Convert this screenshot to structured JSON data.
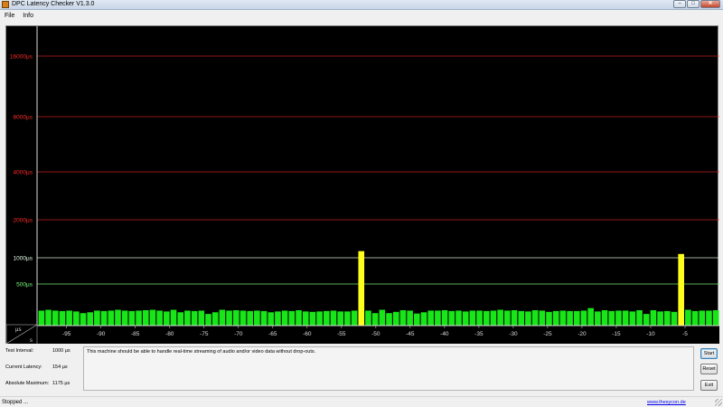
{
  "window": {
    "title": "DPC Latency Checker V1.3.0"
  },
  "menu": {
    "items": [
      "File",
      "Info"
    ]
  },
  "chart_data": {
    "type": "bar",
    "x_unit": "s",
    "y_unit": "µs",
    "y_reference_lines": [
      {
        "label": "16000µs",
        "value": 16000,
        "color": "#ff2a2a"
      },
      {
        "label": "8000µs",
        "value": 8000,
        "color": "#ff2a2a"
      },
      {
        "label": "4000µs",
        "value": 4000,
        "color": "#ff2a2a"
      },
      {
        "label": "2000µs",
        "value": 2000,
        "color": "#ff2a2a"
      },
      {
        "label": "1000µs",
        "value": 1000,
        "color": "#e8ffe8"
      },
      {
        "label": "500µs",
        "value": 500,
        "color": "#7dff7d"
      }
    ],
    "x_ticks": [
      -95,
      -90,
      -85,
      -80,
      -75,
      -70,
      -65,
      -60,
      -55,
      -50,
      -45,
      -40,
      -35,
      -30,
      -25,
      -20,
      -15,
      -10,
      -5
    ],
    "x_range": [
      -99.3,
      0
    ],
    "values": [
      180,
      190,
      180,
      175,
      180,
      170,
      150,
      160,
      180,
      175,
      180,
      190,
      180,
      175,
      180,
      185,
      190,
      180,
      170,
      190,
      160,
      180,
      175,
      180,
      140,
      160,
      190,
      180,
      185,
      180,
      175,
      180,
      175,
      160,
      170,
      180,
      175,
      185,
      170,
      165,
      170,
      175,
      180,
      170,
      170,
      180,
      1175,
      180,
      150,
      190,
      150,
      165,
      185,
      180,
      145,
      160,
      180,
      180,
      185,
      175,
      180,
      170,
      180,
      180,
      175,
      180,
      190,
      180,
      185,
      175,
      170,
      185,
      180,
      165,
      175,
      180,
      175,
      175,
      180,
      210,
      170,
      185,
      175,
      180,
      180,
      170,
      185,
      140,
      185,
      170,
      175,
      165,
      1100,
      190,
      175,
      180,
      180,
      185
    ],
    "bar_colors": {
      "normal": "#19e619",
      "warning": "#ffff1e"
    }
  },
  "fields": [
    {
      "label": "Test Interval:",
      "value": "1000 µs"
    },
    {
      "label": "Current Latency:",
      "value": "154 µs"
    },
    {
      "label": "Absolute Maximum:",
      "value": "1175 µs"
    }
  ],
  "message": "This machine should be able to handle real-time streaming of audio and/or video data without drop-outs.",
  "buttons": {
    "start": "Start",
    "reset": "Reset",
    "exit": "Exit"
  },
  "status": {
    "text": "Stopped ...",
    "link": "www.thesycon.de"
  }
}
